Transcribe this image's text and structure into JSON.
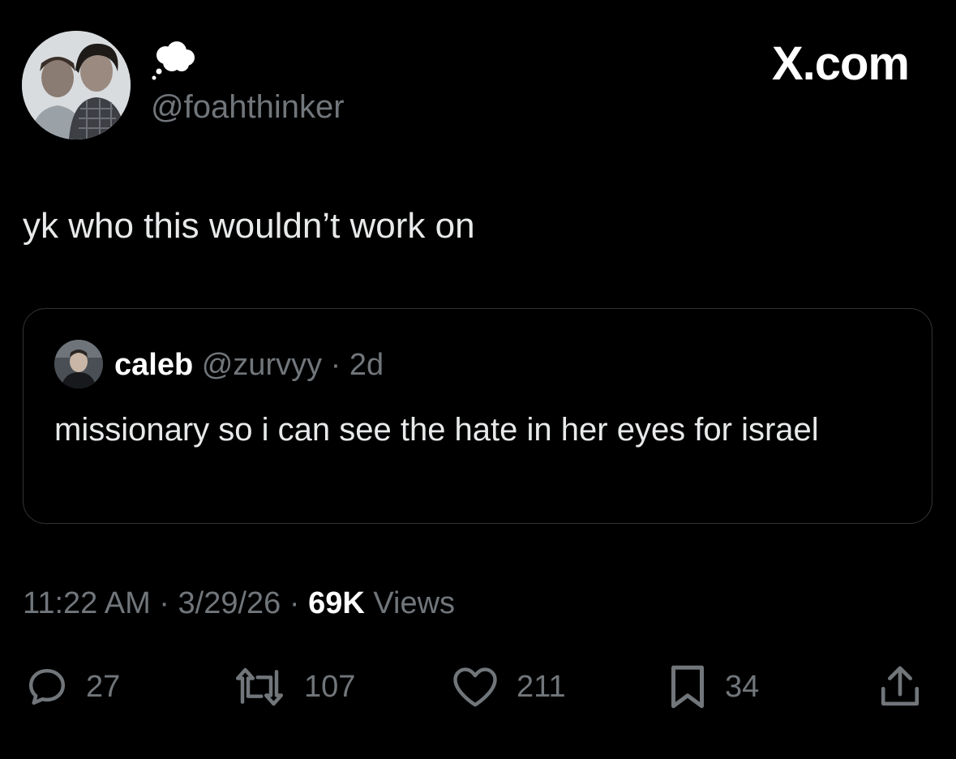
{
  "header": {
    "handle": "@foahthinker",
    "brand": "X.com",
    "avatar_icon": "profile-photo-icon",
    "status_icon": "thought-bubble-icon"
  },
  "tweet": {
    "text": "yk who this wouldn’t work on"
  },
  "quote": {
    "name": "caleb",
    "handle": "@zurvyy",
    "separator": "·",
    "age": "2d",
    "text": "missionary so i can see the hate in her eyes for israel"
  },
  "meta": {
    "time": "11:22 AM",
    "sep1": "·",
    "date": "3/29/26",
    "sep2": "·",
    "views_count": "69K",
    "views_label": "Views"
  },
  "actions": {
    "replies": "27",
    "reposts": "107",
    "likes": "211",
    "bookmarks": "34",
    "icons": [
      "reply-icon",
      "repost-icon",
      "like-icon",
      "bookmark-icon",
      "share-icon"
    ]
  },
  "colors": {
    "background": "#000000",
    "text": "#e7e9ea",
    "muted": "#71767b",
    "border": "#2f3336"
  }
}
